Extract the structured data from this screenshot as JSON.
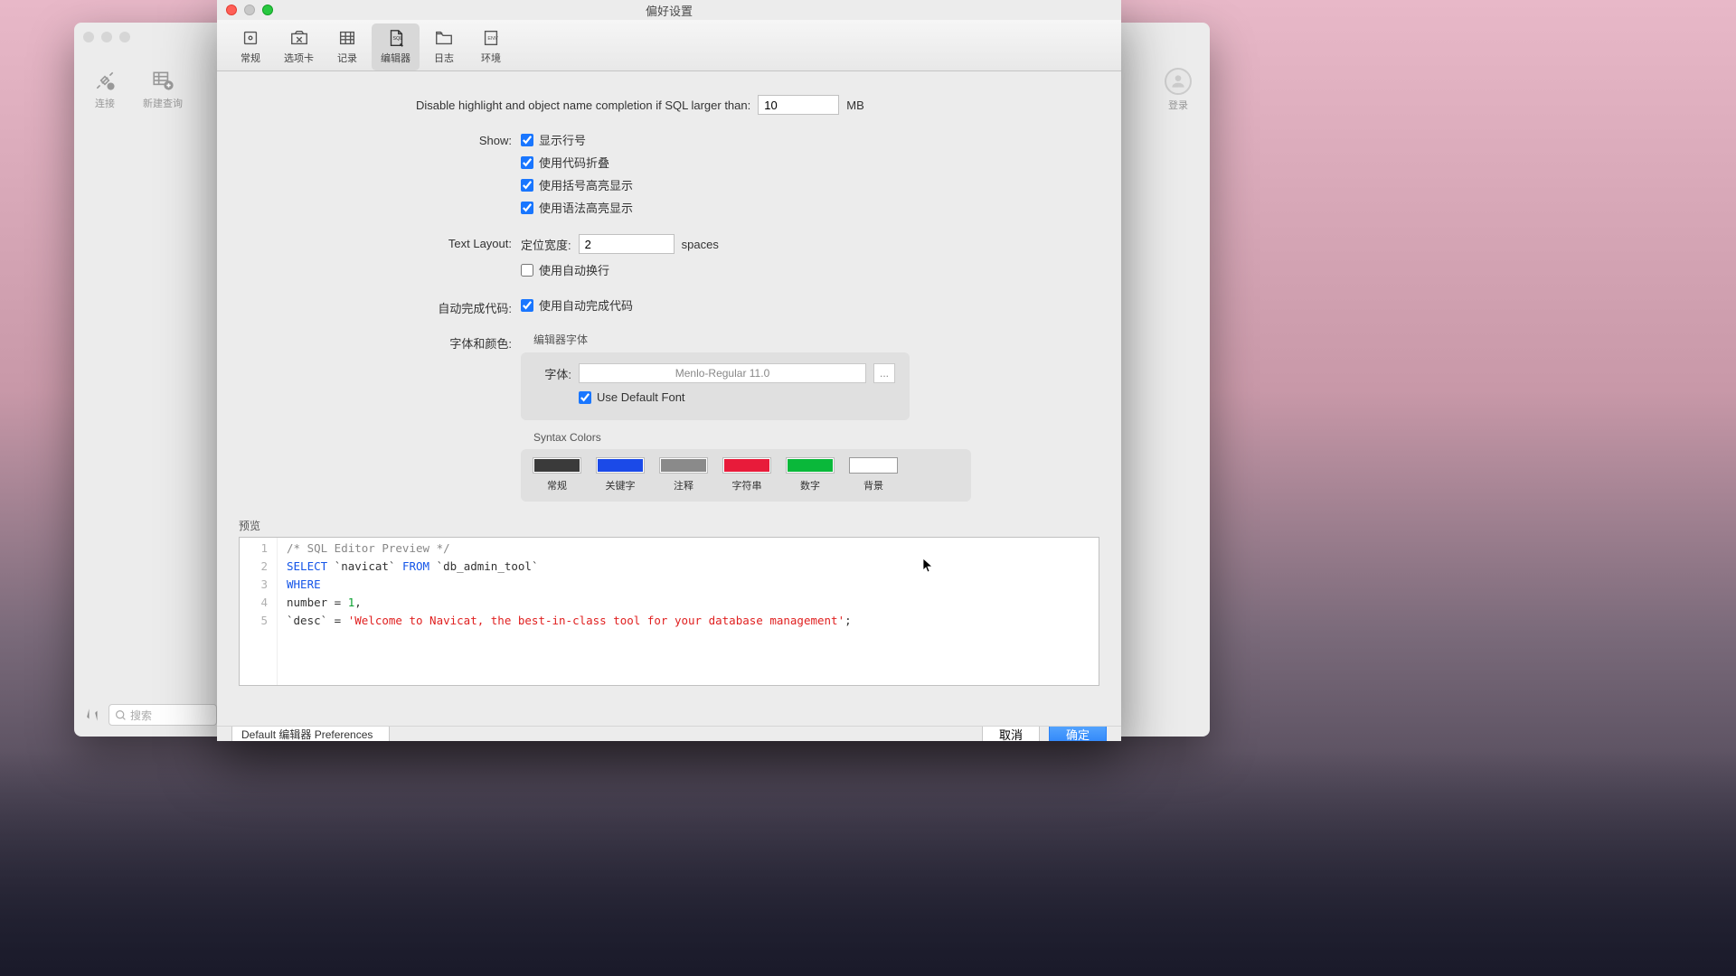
{
  "bg_window": {
    "toolbar": {
      "connect": "连接",
      "new_query": "新建查询",
      "login": "登录"
    },
    "search_placeholder": "搜索"
  },
  "pref": {
    "title": "偏好设置",
    "tabs": {
      "general": "常规",
      "tabs_": "选项卡",
      "records": "记录",
      "editor": "编辑器",
      "log": "日志",
      "env": "环境"
    },
    "disable_hl_label": "Disable highlight and object name completion if SQL larger than:",
    "disable_hl_value": "10",
    "disable_hl_unit": "MB",
    "show_label": "Show:",
    "show_line_numbers": "显示行号",
    "use_code_folding": "使用代码折叠",
    "use_bracket_hl": "使用括号高亮显示",
    "use_syntax_hl": "使用语法高亮显示",
    "text_layout_label": "Text Layout:",
    "tab_width_label": "定位宽度:",
    "tab_width_value": "2",
    "spaces_unit": "spaces",
    "use_word_wrap": "使用自动换行",
    "autocomplete_label": "自动完成代码:",
    "use_autocomplete": "使用自动完成代码",
    "font_color_label": "字体和颜色:",
    "editor_font_title": "编辑器字体",
    "font_label": "字体:",
    "font_value": "Menlo-Regular 11.0",
    "font_browse": "...",
    "use_default_font": "Use Default Font",
    "syntax_colors_title": "Syntax Colors",
    "swatches": [
      {
        "name": "常规",
        "color": "#3a3a3a"
      },
      {
        "name": "关键字",
        "color": "#1b4ae8"
      },
      {
        "name": "注释",
        "color": "#8a8a8a"
      },
      {
        "name": "字符串",
        "color": "#e81b3a"
      },
      {
        "name": "数字",
        "color": "#0ab83a"
      },
      {
        "name": "背景",
        "color": "#ffffff"
      }
    ],
    "preview_label": "预览",
    "preview": {
      "l1": "/* SQL Editor Preview */",
      "l2_select": "SELECT",
      "l2_t1": "`navicat`",
      "l2_from": "FROM",
      "l2_t2": "`db_admin_tool`",
      "l3_where": "WHERE",
      "l4_pre": "  number = ",
      "l4_num": "1",
      "l4_post": ",",
      "l5_pre": "  `desc` = ",
      "l5_str": "'Welcome to Navicat, the best-in-class tool for your database management'",
      "l5_post": ";"
    },
    "preset_label": "Default 编辑器 Preferences",
    "cancel": "取消",
    "ok": "确定"
  }
}
